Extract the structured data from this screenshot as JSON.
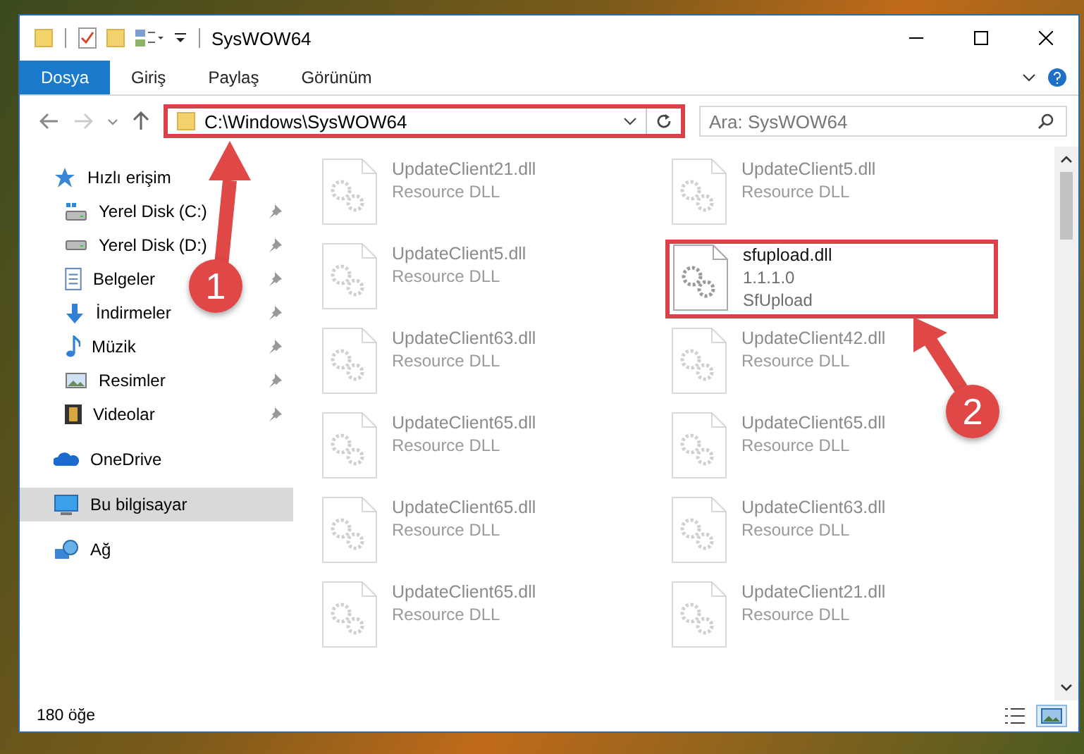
{
  "window": {
    "title": "SysWOW64"
  },
  "ribbon_tabs": [
    {
      "label": "Dosya",
      "selected": true
    },
    {
      "label": "Giriş",
      "selected": false
    },
    {
      "label": "Paylaş",
      "selected": false
    },
    {
      "label": "Görünüm",
      "selected": false
    }
  ],
  "address_bar": {
    "path": "C:\\Windows\\SysWOW64",
    "highlighted": true
  },
  "search": {
    "placeholder": "Ara: SysWOW64"
  },
  "navigation": [
    {
      "label": "Hızlı erişim",
      "kind": "star",
      "selected": false,
      "children": [
        {
          "label": "Yerel Disk (C:)",
          "kind": "drive-win",
          "pinned": true
        },
        {
          "label": "Yerel Disk (D:)",
          "kind": "drive",
          "pinned": true
        },
        {
          "label": "Belgeler",
          "kind": "document",
          "pinned": true
        },
        {
          "label": "İndirmeler",
          "kind": "download",
          "pinned": true
        },
        {
          "label": "Müzik",
          "kind": "music",
          "pinned": true
        },
        {
          "label": "Resimler",
          "kind": "picture",
          "pinned": true
        },
        {
          "label": "Videolar",
          "kind": "video",
          "pinned": true
        }
      ]
    },
    {
      "label": "OneDrive",
      "kind": "cloud",
      "selected": false
    },
    {
      "label": "Bu bilgisayar",
      "kind": "computer",
      "selected": true
    },
    {
      "label": "Ağ",
      "kind": "network",
      "selected": false
    }
  ],
  "files": [
    {
      "kind": "faded",
      "lines": [
        "UpdateClient21.dll",
        "Resource DLL"
      ]
    },
    {
      "kind": "faded",
      "lines": [
        "UpdateClient5.dll",
        "Resource DLL"
      ]
    },
    {
      "kind": "faded",
      "lines": [
        "UpdateClient5.dll",
        "Resource DLL"
      ]
    },
    {
      "kind": "focus",
      "lines": [
        "sfupload.dll",
        "1.1.1.0",
        "SfUpload"
      ],
      "highlighted": true
    },
    {
      "kind": "faded",
      "lines": [
        "UpdateClient63.dll",
        "Resource DLL"
      ]
    },
    {
      "kind": "faded",
      "lines": [
        "UpdateClient42.dll",
        "Resource DLL"
      ]
    },
    {
      "kind": "faded",
      "lines": [
        "UpdateClient65.dll",
        "Resource DLL"
      ]
    },
    {
      "kind": "faded",
      "lines": [
        "UpdateClient65.dll",
        "Resource DLL"
      ]
    },
    {
      "kind": "faded",
      "lines": [
        "UpdateClient65.dll",
        "Resource DLL"
      ]
    },
    {
      "kind": "faded",
      "lines": [
        "UpdateClient63.dll",
        "Resource DLL"
      ]
    },
    {
      "kind": "faded",
      "lines": [
        "UpdateClient65.dll",
        "Resource DLL"
      ]
    },
    {
      "kind": "faded",
      "lines": [
        "UpdateClient21.dll",
        "Resource DLL"
      ]
    }
  ],
  "status_bar": {
    "count": "180 öğe",
    "views": [
      {
        "kind": "details",
        "selected": false
      },
      {
        "kind": "large-icons",
        "selected": true
      }
    ]
  },
  "annotations": [
    {
      "number": "1"
    },
    {
      "number": "2"
    }
  ]
}
